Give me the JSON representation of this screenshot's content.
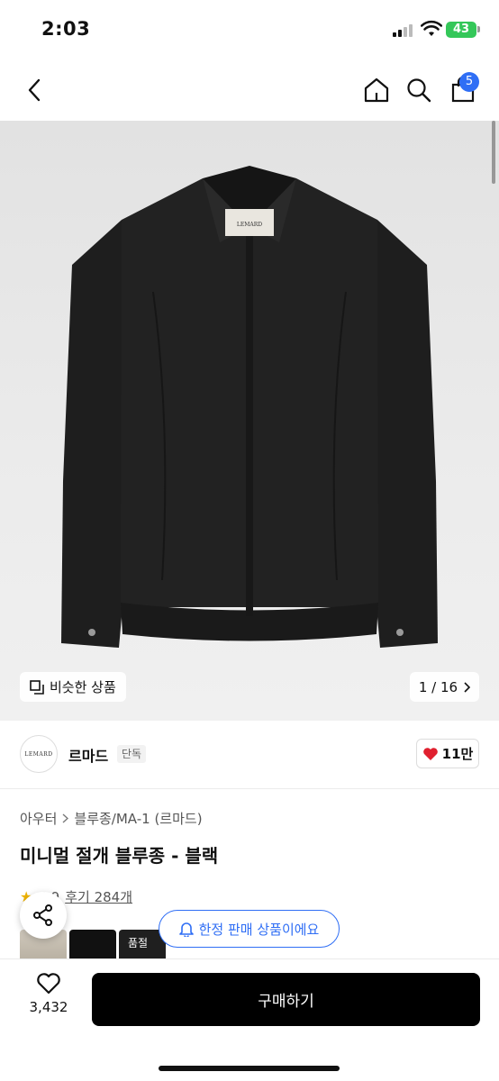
{
  "status_bar": {
    "time": "2:03",
    "battery": "43"
  },
  "nav": {
    "cart_count": "5",
    "icons": [
      "back-arrow-icon",
      "home-icon",
      "search-icon",
      "shopping-bag-icon"
    ]
  },
  "gallery": {
    "label_tag": "LEMARD",
    "similar_label": "비슷한 상품",
    "counter": "1 / 16"
  },
  "brand": {
    "logo_text": "LEMARD",
    "name": "르마드",
    "tag": "단독",
    "likes": "11만"
  },
  "breadcrumb": {
    "category": "아우터",
    "subcategory": "블루종/MA-1 (르마드)"
  },
  "product": {
    "title": "미니멀 절개 블루종 - 블랙"
  },
  "rating": {
    "score": "4.9",
    "reviews": "후기 284개"
  },
  "limited_label": "한정 판매 상품이에요",
  "thumbnails": {
    "third_label": "품절"
  },
  "bottom": {
    "wish_count": "3,432",
    "buy_label": "구매하기"
  },
  "colors": {
    "accent": "#2f6ef5",
    "like_red": "#e0202f",
    "battery": "#34c759"
  }
}
